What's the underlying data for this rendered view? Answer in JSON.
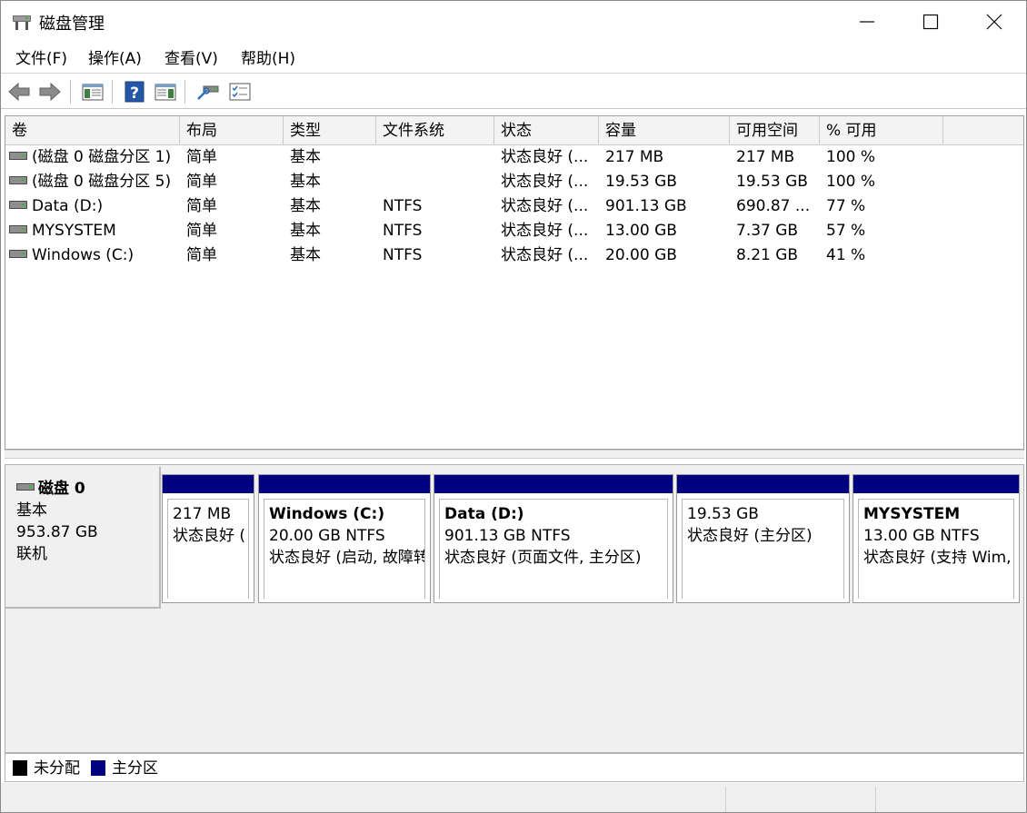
{
  "window": {
    "title": "磁盘管理",
    "icon": "disk-management-icon",
    "controls": [
      "minimize-icon",
      "maximize-icon",
      "close-icon"
    ]
  },
  "menu": [
    {
      "label": "文件(F)"
    },
    {
      "label": "操作(A)"
    },
    {
      "label": "查看(V)"
    },
    {
      "label": "帮助(H)"
    }
  ],
  "toolbar": [
    "back-arrow-icon",
    "forward-arrow-icon",
    "show-hide-console-tree-icon",
    "help-icon",
    "show-hide-action-pane-icon",
    "rescan-disks-icon",
    "properties-checklist-icon"
  ],
  "columns": [
    "卷",
    "布局",
    "类型",
    "文件系统",
    "状态",
    "容量",
    "可用空间",
    "% 可用"
  ],
  "volumes": [
    {
      "name": "(磁盘 0 磁盘分区 1)",
      "layout": "简单",
      "type": "基本",
      "fs": "",
      "status": "状态良好 (...",
      "capacity": "217 MB",
      "free": "217 MB",
      "pct": "100 %"
    },
    {
      "name": "(磁盘 0 磁盘分区 5)",
      "layout": "简单",
      "type": "基本",
      "fs": "",
      "status": "状态良好 (...",
      "capacity": "19.53 GB",
      "free": "19.53 GB",
      "pct": "100 %"
    },
    {
      "name": "Data (D:)",
      "layout": "简单",
      "type": "基本",
      "fs": "NTFS",
      "status": "状态良好 (...",
      "capacity": "901.13 GB",
      "free": "690.87 ...",
      "pct": "77 %"
    },
    {
      "name": "MYSYSTEM",
      "layout": "简单",
      "type": "基本",
      "fs": "NTFS",
      "status": "状态良好 (...",
      "capacity": "13.00 GB",
      "free": "7.37 GB",
      "pct": "57 %"
    },
    {
      "name": "Windows (C:)",
      "layout": "简单",
      "type": "基本",
      "fs": "NTFS",
      "status": "状态良好 (...",
      "capacity": "20.00 GB",
      "free": "8.21 GB",
      "pct": "41 %"
    }
  ],
  "disk": {
    "name": "磁盘 0",
    "kind": "基本",
    "size": "953.87 GB",
    "state": "联机"
  },
  "partitions": [
    {
      "title": "",
      "line1": "217 MB",
      "line2": "状态良好 ("
    },
    {
      "title": "Windows  (C:)",
      "line1": "20.00 GB NTFS",
      "line2": "状态良好 (启动, 故障转"
    },
    {
      "title": "Data  (D:)",
      "line1": "901.13 GB NTFS",
      "line2": "状态良好 (页面文件, 主分区)"
    },
    {
      "title": "",
      "line1": "19.53 GB",
      "line2": "状态良好 (主分区)"
    },
    {
      "title": "MYSYSTEM",
      "line1": "13.00 GB NTFS",
      "line2": "状态良好 (支持 Wim,"
    }
  ],
  "legend": [
    {
      "label": "未分配",
      "color": "#000000"
    },
    {
      "label": "主分区",
      "color": "#000080"
    }
  ],
  "colors": {
    "primary_partition": "#000080",
    "unallocated": "#000000"
  }
}
